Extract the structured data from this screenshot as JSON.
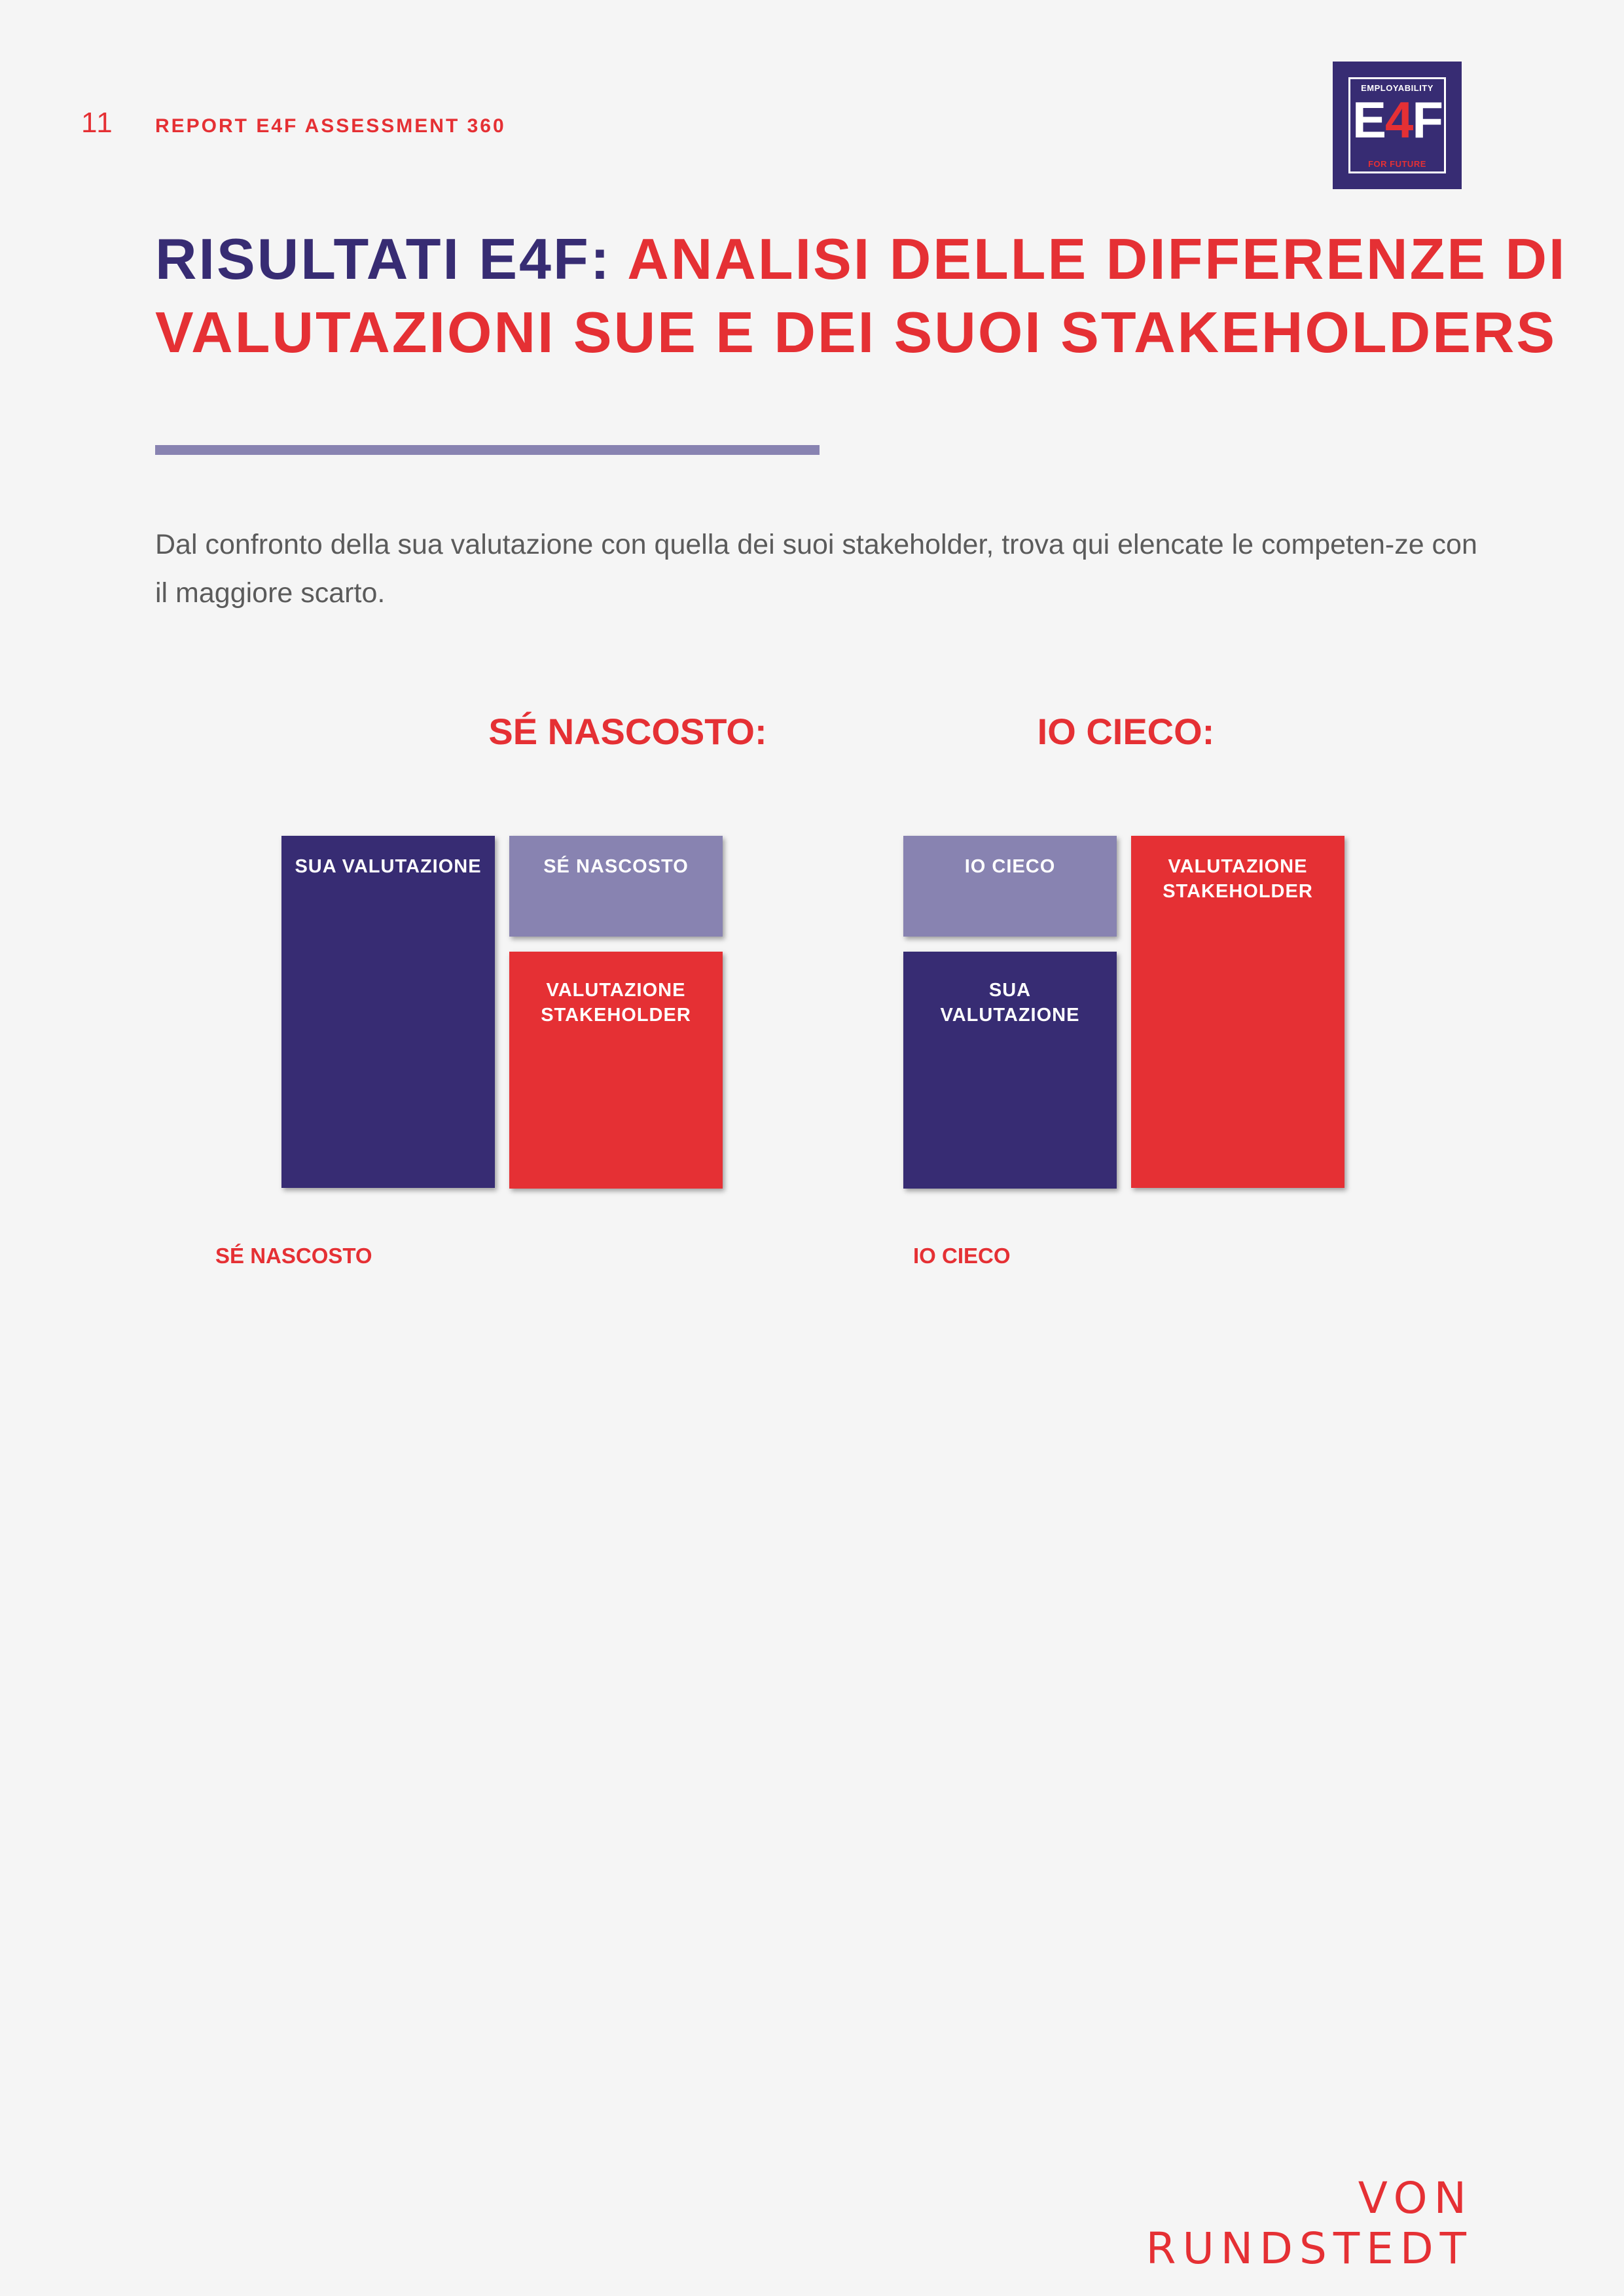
{
  "header": {
    "page_number": "11",
    "report_title": "REPORT E4F ASSESSMENT 360",
    "logo": {
      "top_text": "EMPLOYABILITY",
      "main_e": "E",
      "main_4": "4",
      "main_f": "F",
      "bottom_text": "FOR FUTURE"
    }
  },
  "heading": {
    "part_blue": "RISULTATI E4F: ",
    "part_red": "ANALISI DELLE DIFFERENZE DI VALUTAZIONI SUE E DEI SUOI STAKEHOLDERS"
  },
  "intro": "Dal confronto della sua valutazione con quella dei suoi stakeholder, trova qui elencate le competen-ze con il maggiore scarto.",
  "sections": {
    "hidden": {
      "title": "SÉ NASCOSTO:",
      "box_self": "SUA VALUTAZIONE",
      "box_gap": "SÉ NASCOSTO",
      "box_stakeholder": "VALUTAZIONE STAKEHOLDER",
      "list_label": "SÉ NASCOSTO"
    },
    "blind": {
      "title": "IO CIECO:",
      "box_gap": "IO CIECO",
      "box_self": "SUA VALUTAZIONE",
      "box_stakeholder": "VALUTAZIONE STAKEHOLDER",
      "list_label": "IO CIECO"
    }
  },
  "footer": {
    "brand": "VON RUNDSTEDT"
  },
  "colors": {
    "red": "#e53034",
    "navy": "#372c73",
    "lavender": "#8883b1",
    "background": "#f5f5f5"
  }
}
